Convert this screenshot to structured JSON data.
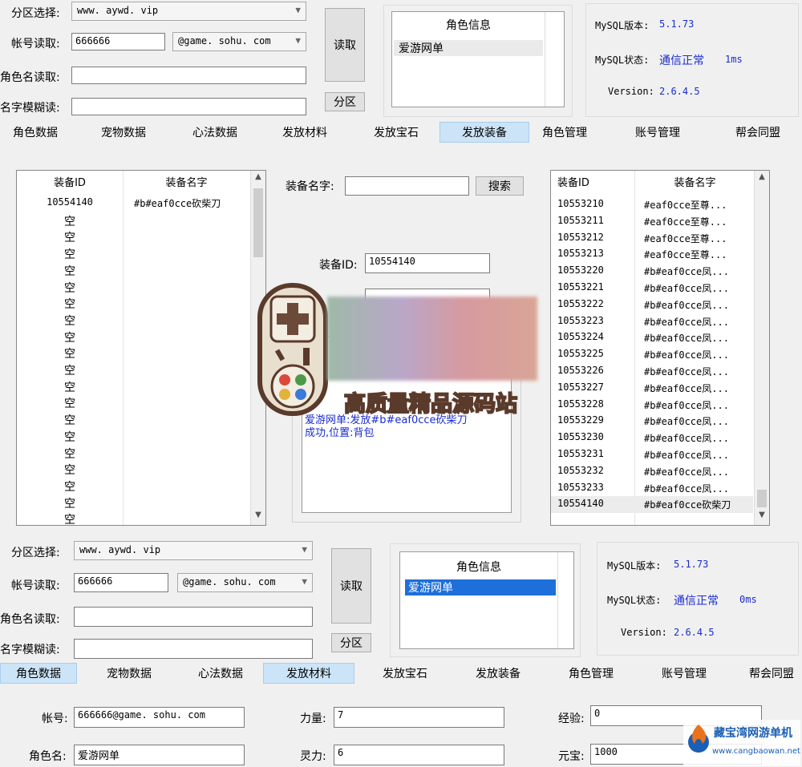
{
  "top": {
    "server_label": "分区选择:",
    "server_value": "www. aywd. vip",
    "account_label": "帐号读取:",
    "account_value": "666666",
    "domain_value": "@game. sohu. com",
    "role_name_label": "角色名读取:",
    "fuzzy_label": "名字模糊读:",
    "read_button": "读取",
    "zone_button": "分区",
    "role_info_title": "角色信息",
    "role_info_items": [
      "爱游网单"
    ],
    "mysql_version_label": "MySQL版本:",
    "mysql_version_value": "5.1.73",
    "mysql_status_label": "MySQL状态:",
    "mysql_status_value": "通信正常",
    "mysql_latency": "1ms",
    "version_label": "Version:",
    "version_value": "2.6.4.5"
  },
  "tabs_top": [
    "角色数据",
    "宠物数据",
    "心法数据",
    "发放材料",
    "发放宝石",
    "发放装备",
    "角色管理",
    "账号管理",
    "帮会同盟"
  ],
  "tabs_top_active": 5,
  "left_list": {
    "col_id": "装备ID",
    "col_name": "装备名字",
    "first_id": "10554140",
    "first_name": "#b#eaf0cce砍柴刀",
    "empty_label": "空"
  },
  "middle": {
    "equip_name_label": "装备名字:",
    "search_button": "搜索",
    "equip_id_label": "装备ID:",
    "equip_id_value": "10554140",
    "log_line1": "爱游网单:发放#b#eaf0cce砍柴刀",
    "log_line2": "成功,位置:背包",
    "watermark": "高质量精品源码站"
  },
  "right_list": {
    "col_id": "装备ID",
    "col_name": "装备名字",
    "rows": [
      [
        "10553210",
        "#eaf0cce至尊..."
      ],
      [
        "10553211",
        "#eaf0cce至尊..."
      ],
      [
        "10553212",
        "#eaf0cce至尊..."
      ],
      [
        "10553213",
        "#eaf0cce至尊..."
      ],
      [
        "10553220",
        "#b#eaf0cce凤..."
      ],
      [
        "10553221",
        "#b#eaf0cce凤..."
      ],
      [
        "10553222",
        "#b#eaf0cce凤..."
      ],
      [
        "10553223",
        "#b#eaf0cce凤..."
      ],
      [
        "10553224",
        "#b#eaf0cce凤..."
      ],
      [
        "10553225",
        "#b#eaf0cce凤..."
      ],
      [
        "10553226",
        "#b#eaf0cce凤..."
      ],
      [
        "10553227",
        "#b#eaf0cce凤..."
      ],
      [
        "10553228",
        "#b#eaf0cce凤..."
      ],
      [
        "10553229",
        "#b#eaf0cce凤..."
      ],
      [
        "10553230",
        "#b#eaf0cce凤..."
      ],
      [
        "10553231",
        "#b#eaf0cce凤..."
      ],
      [
        "10553232",
        "#b#eaf0cce凤..."
      ],
      [
        "10553233",
        "#b#eaf0cce凤..."
      ],
      [
        "10554140",
        "#b#eaf0cce砍柴刀"
      ]
    ]
  },
  "bottom": {
    "server_label": "分区选择:",
    "server_value": "www. aywd. vip",
    "account_label": "帐号读取:",
    "account_value": "666666",
    "domain_value": "@game. sohu. com",
    "role_name_label": "角色名读取:",
    "fuzzy_label": "名字模糊读:",
    "read_button": "读取",
    "zone_button": "分区",
    "role_info_title": "角色信息",
    "role_info_items": [
      "爱游网单"
    ],
    "mysql_version_label": "MySQL版本:",
    "mysql_version_value": "5.1.73",
    "mysql_status_label": "MySQL状态:",
    "mysql_status_value": "通信正常",
    "mysql_latency": "0ms",
    "version_label": "Version:",
    "version_value": "2.6.4.5"
  },
  "tabs_bottom": [
    "角色数据",
    "宠物数据",
    "心法数据",
    "发放材料",
    "发放宝石",
    "发放装备",
    "角色管理",
    "账号管理",
    "帮会同盟"
  ],
  "tabs_bottom_active": [
    0,
    3
  ],
  "form": {
    "account_label": "帐号:",
    "account_value": "666666@game. sohu. com",
    "role_label": "角色名:",
    "role_value": "爱游网单",
    "strength_label": "力量:",
    "strength_value": "7",
    "spirit_label": "灵力:",
    "spirit_value": "6",
    "exp_label": "经验:",
    "exp_value": "0",
    "gold_label": "元宝:",
    "gold_value": "1000"
  },
  "corner_logo": {
    "title": "藏宝湾网游单机",
    "url": "www.cangbaowan.net"
  },
  "colors": {
    "tab_active": "#cce4f7",
    "selection": "#1e6fd9",
    "blue_text": "#1a2ccf"
  }
}
